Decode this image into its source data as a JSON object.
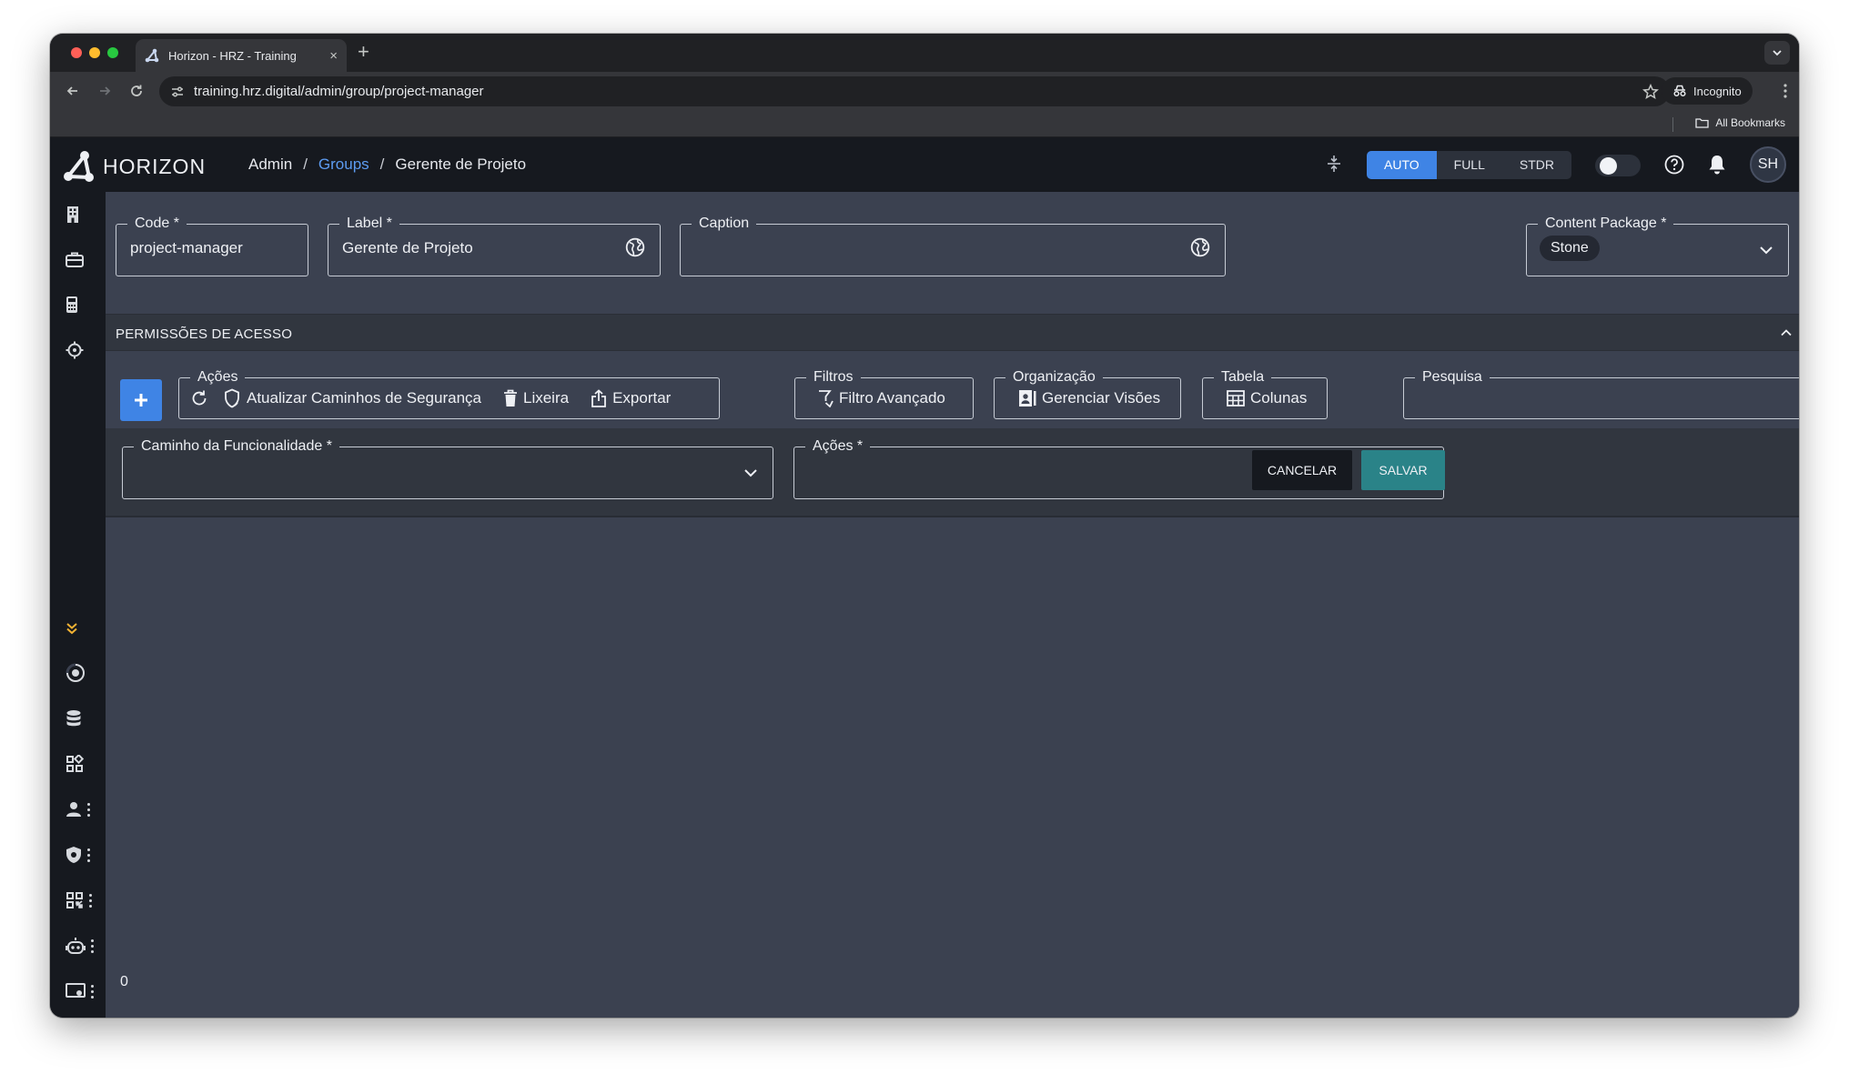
{
  "browser": {
    "tab_title": "Horizon - HRZ - Training",
    "new_tab": "+",
    "close_tab": "×",
    "url": "training.hrz.digital/admin/group/project-manager",
    "incognito_label": "Incognito",
    "bookmarks_label": "All Bookmarks",
    "traffic_lights": [
      "#ff5f57",
      "#febc2e",
      "#28c840"
    ]
  },
  "app": {
    "logo_text": "HORIZON",
    "breadcrumb": {
      "root": "Admin",
      "separator": "/",
      "link": "Groups",
      "current": "Gerente de Projeto"
    },
    "modes": [
      "AUTO",
      "FULL",
      "STDR"
    ],
    "active_mode": "AUTO",
    "avatar_initials": "SH",
    "colors": {
      "accent": "#3f84e5",
      "link": "#5d9cf2",
      "save": "#2a8388",
      "warning_icon": "#f2b233"
    }
  },
  "sidebar": {
    "top_icons": [
      "building-icon",
      "briefcase-icon",
      "calculator-icon",
      "crosshair-icon"
    ],
    "expand_icon": "double-chevron-down-icon",
    "bottom_icons": [
      "radar-icon",
      "database-icon",
      "apps-icon",
      "user-settings-icon",
      "shield-settings-icon",
      "qr-code-icon",
      "robot-icon",
      "screen-settings-icon"
    ]
  },
  "form": {
    "code": {
      "label": "Code *",
      "value": "project-manager"
    },
    "label": {
      "label": "Label *",
      "value": "Gerente de Projeto"
    },
    "caption": {
      "label": "Caption",
      "value": ""
    },
    "content_package": {
      "label": "Content Package *",
      "value": "Stone"
    }
  },
  "permissions": {
    "title": "PERMISSÕES DE ACESSO",
    "actions_group": {
      "label": "Ações",
      "refresh_security": "Atualizar Caminhos de Segurança",
      "trash": "Lixeira",
      "export": "Exportar"
    },
    "filters_group": {
      "label": "Filtros",
      "advanced_filter": "Filtro Avançado"
    },
    "organization_group": {
      "label": "Organização",
      "manage_views": "Gerenciar Visões"
    },
    "table_group": {
      "label": "Tabela",
      "columns": "Colunas"
    },
    "search": {
      "label": "Pesquisa",
      "value": ""
    },
    "new_entry": {
      "path_label": "Caminho da Funcionalidade *",
      "actions_label": "Ações *",
      "cancel": "CANCELAR",
      "save": "SALVAR"
    },
    "row_count": "0"
  }
}
